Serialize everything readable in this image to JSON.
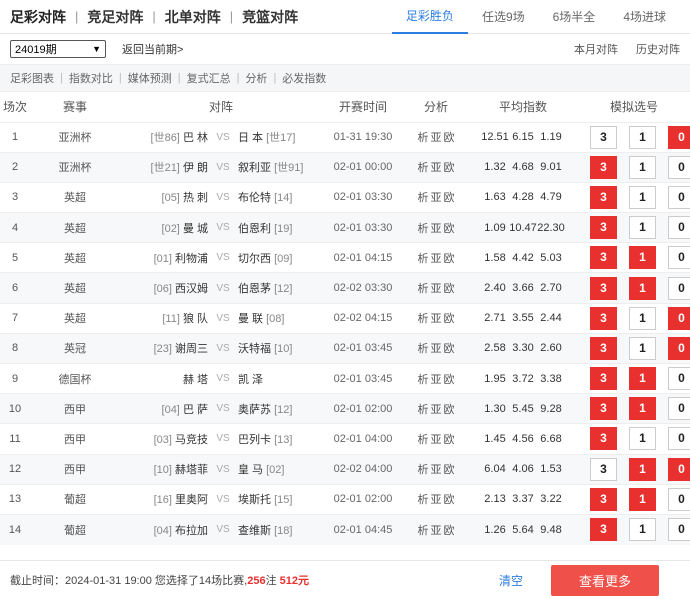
{
  "nav": {
    "main": [
      "足彩对阵",
      "竞足对阵",
      "北单对阵",
      "竞篮对阵"
    ],
    "tabs": [
      "足彩胜负",
      "任选9场",
      "6场半全",
      "4场进球"
    ]
  },
  "period": {
    "selected": "24019期",
    "back": "返回当前期>",
    "links": [
      "本月对阵",
      "历史对阵"
    ]
  },
  "tools": [
    "足彩图表",
    "指数对比",
    "媒体预测",
    "复式汇总",
    "分析",
    "必发指数"
  ],
  "headers": [
    "场次",
    "赛事",
    "对阵",
    "开赛时间",
    "分析",
    "平均指数",
    "模拟选号"
  ],
  "vs_text": "VS",
  "analysis_links": [
    "析",
    "亚",
    "欧"
  ],
  "rows": [
    {
      "no": "1",
      "league": "亚洲杯",
      "home_rank": "[世86]",
      "home": "巴 林",
      "away": "日 本",
      "away_rank": "[世17]",
      "time": "01-31 19:30",
      "odds": [
        "12.51",
        "6.15",
        "1.19"
      ],
      "picks": [
        {
          "label": "3",
          "on": false
        },
        {
          "label": "1",
          "on": false
        },
        {
          "label": "0",
          "on": true
        }
      ]
    },
    {
      "no": "2",
      "league": "亚洲杯",
      "home_rank": "[世21]",
      "home": "伊 朗",
      "away": "叙利亚",
      "away_rank": "[世91]",
      "time": "02-01 00:00",
      "odds": [
        "1.32",
        "4.68",
        "9.01"
      ],
      "picks": [
        {
          "label": "3",
          "on": true
        },
        {
          "label": "1",
          "on": false
        },
        {
          "label": "0",
          "on": false
        }
      ]
    },
    {
      "no": "3",
      "league": "英超",
      "home_rank": "[05]",
      "home": "热 刺",
      "away": "布伦特",
      "away_rank": "[14]",
      "time": "02-01 03:30",
      "odds": [
        "1.63",
        "4.28",
        "4.79"
      ],
      "picks": [
        {
          "label": "3",
          "on": true
        },
        {
          "label": "1",
          "on": false
        },
        {
          "label": "0",
          "on": false
        }
      ]
    },
    {
      "no": "4",
      "league": "英超",
      "home_rank": "[02]",
      "home": "曼 城",
      "away": "伯恩利",
      "away_rank": "[19]",
      "time": "02-01 03:30",
      "odds": [
        "1.09",
        "10.47",
        "22.30"
      ],
      "picks": [
        {
          "label": "3",
          "on": true
        },
        {
          "label": "1",
          "on": false
        },
        {
          "label": "0",
          "on": false
        }
      ]
    },
    {
      "no": "5",
      "league": "英超",
      "home_rank": "[01]",
      "home": "利物浦",
      "away": "切尔西",
      "away_rank": "[09]",
      "time": "02-01 04:15",
      "odds": [
        "1.58",
        "4.42",
        "5.03"
      ],
      "picks": [
        {
          "label": "3",
          "on": true
        },
        {
          "label": "1",
          "on": true
        },
        {
          "label": "0",
          "on": false
        }
      ]
    },
    {
      "no": "6",
      "league": "英超",
      "home_rank": "[06]",
      "home": "西汉姆",
      "away": "伯恩茅",
      "away_rank": "[12]",
      "time": "02-02 03:30",
      "odds": [
        "2.40",
        "3.66",
        "2.70"
      ],
      "picks": [
        {
          "label": "3",
          "on": true
        },
        {
          "label": "1",
          "on": true
        },
        {
          "label": "0",
          "on": false
        }
      ]
    },
    {
      "no": "7",
      "league": "英超",
      "home_rank": "[11]",
      "home": "狼 队",
      "away": "曼 联",
      "away_rank": "[08]",
      "time": "02-02 04:15",
      "odds": [
        "2.71",
        "3.55",
        "2.44"
      ],
      "picks": [
        {
          "label": "3",
          "on": true
        },
        {
          "label": "1",
          "on": false
        },
        {
          "label": "0",
          "on": true
        }
      ]
    },
    {
      "no": "8",
      "league": "英冠",
      "home_rank": "[23]",
      "home": "谢周三",
      "away": "沃特福",
      "away_rank": "[10]",
      "time": "02-01 03:45",
      "odds": [
        "2.58",
        "3.30",
        "2.60"
      ],
      "picks": [
        {
          "label": "3",
          "on": true
        },
        {
          "label": "1",
          "on": false
        },
        {
          "label": "0",
          "on": true
        }
      ]
    },
    {
      "no": "9",
      "league": "德国杯",
      "home_rank": "",
      "home": "赫 塔",
      "away": "凯 泽",
      "away_rank": "",
      "time": "02-01 03:45",
      "odds": [
        "1.95",
        "3.72",
        "3.38"
      ],
      "picks": [
        {
          "label": "3",
          "on": true
        },
        {
          "label": "1",
          "on": true
        },
        {
          "label": "0",
          "on": false
        }
      ]
    },
    {
      "no": "10",
      "league": "西甲",
      "home_rank": "[04]",
      "home": "巴 萨",
      "away": "奥萨苏",
      "away_rank": "[12]",
      "time": "02-01 02:00",
      "odds": [
        "1.30",
        "5.45",
        "9.28"
      ],
      "picks": [
        {
          "label": "3",
          "on": true
        },
        {
          "label": "1",
          "on": true
        },
        {
          "label": "0",
          "on": false
        }
      ]
    },
    {
      "no": "11",
      "league": "西甲",
      "home_rank": "[03]",
      "home": "马竞技",
      "away": "巴列卡",
      "away_rank": "[13]",
      "time": "02-01 04:00",
      "odds": [
        "1.45",
        "4.56",
        "6.68"
      ],
      "picks": [
        {
          "label": "3",
          "on": true
        },
        {
          "label": "1",
          "on": false
        },
        {
          "label": "0",
          "on": false
        }
      ]
    },
    {
      "no": "12",
      "league": "西甲",
      "home_rank": "[10]",
      "home": "赫塔菲",
      "away": "皇 马",
      "away_rank": "[02]",
      "time": "02-02 04:00",
      "odds": [
        "6.04",
        "4.06",
        "1.53"
      ],
      "picks": [
        {
          "label": "3",
          "on": false
        },
        {
          "label": "1",
          "on": true
        },
        {
          "label": "0",
          "on": true
        }
      ]
    },
    {
      "no": "13",
      "league": "葡超",
      "home_rank": "[16]",
      "home": "里奥阿",
      "away": "埃斯托",
      "away_rank": "[15]",
      "time": "02-01 02:00",
      "odds": [
        "2.13",
        "3.37",
        "3.22"
      ],
      "picks": [
        {
          "label": "3",
          "on": true
        },
        {
          "label": "1",
          "on": true
        },
        {
          "label": "0",
          "on": false
        }
      ]
    },
    {
      "no": "14",
      "league": "葡超",
      "home_rank": "[04]",
      "home": "布拉加",
      "away": "查维斯",
      "away_rank": "[18]",
      "time": "02-01 04:45",
      "odds": [
        "1.26",
        "5.64",
        "9.48"
      ],
      "picks": [
        {
          "label": "3",
          "on": true
        },
        {
          "label": "1",
          "on": false
        },
        {
          "label": "0",
          "on": false
        }
      ]
    }
  ],
  "footer": {
    "prefix": "截止时间：2024-01-31 19:00 您选择了14场比赛,",
    "count": "256",
    "unit": "注",
    "amount": "512元",
    "clear": "清空",
    "more": "查看更多"
  },
  "colors": {
    "accent_blue": "#2b7de0",
    "pick_red": "#e8302f",
    "button_red": "#f0504a"
  }
}
